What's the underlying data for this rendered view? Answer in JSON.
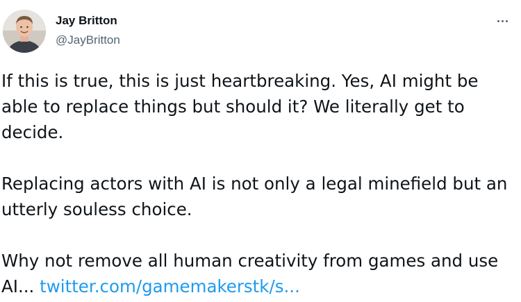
{
  "author": {
    "display_name": "Jay Britton",
    "handle": "@JayBritton",
    "avatar_icon": "user-avatar-photo"
  },
  "more_icon": "more-horizontal-icon",
  "tweet": {
    "paragraphs": [
      "If this is true, this is just heartbreaking. Yes, AI might be able to replace things but should it? We literally get to decide.",
      "Replacing actors with AI is not only a legal minefield but an utterly souless choice."
    ],
    "last_paragraph_text": "Why not remove all human creativity from games and use AI... ",
    "link_text": "twitter.com/gamemakerstk/s..."
  },
  "colors": {
    "text": "#0f1419",
    "secondary": "#536471",
    "link": "#1d9bf0"
  }
}
